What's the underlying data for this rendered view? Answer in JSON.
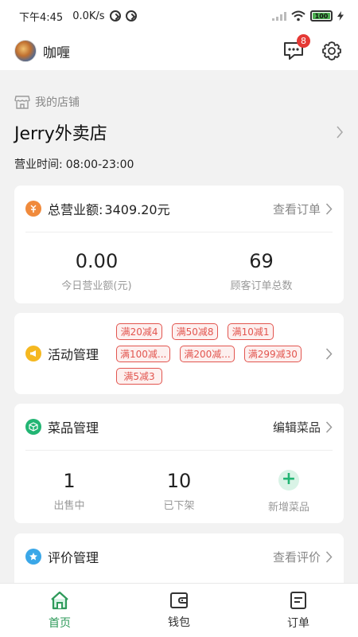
{
  "status": {
    "time": "下午4:45",
    "speed": "0.0K/s",
    "battery": "100"
  },
  "app": {
    "user_name": "咖喱",
    "message_badge": "8"
  },
  "store": {
    "section_label": "我的店铺",
    "name": "Jerry外卖店",
    "hours_label": "营业时间:",
    "hours": "08:00-23:00"
  },
  "revenue": {
    "title_label": "总营业额:",
    "total": "3409.20元",
    "link": "查看订单",
    "stats": [
      {
        "value": "0.00",
        "label": "今日营业额(元)"
      },
      {
        "value": "69",
        "label": "顾客订单总数"
      }
    ]
  },
  "activity": {
    "title": "活动管理",
    "tags": [
      "满20减4",
      "满50减8",
      "满10减1",
      "满100减...",
      "满200减...",
      "满299减30",
      "满5减3"
    ]
  },
  "dishes": {
    "title": "菜品管理",
    "link": "编辑菜品",
    "stats": [
      {
        "value": "1",
        "label": "出售中"
      },
      {
        "value": "10",
        "label": "已下架"
      }
    ],
    "add_label": "新增菜品",
    "add_symbol": "+"
  },
  "reviews": {
    "title": "评价管理",
    "link": "查看评价"
  },
  "tabs": [
    {
      "label": "首页",
      "icon": "home-icon",
      "active": true
    },
    {
      "label": "钱包",
      "icon": "wallet-icon",
      "active": false
    },
    {
      "label": "订单",
      "icon": "order-icon",
      "active": false
    }
  ],
  "colors": {
    "accent": "#2e9a5a",
    "tag_red": "#e2554f",
    "revenue_icon": "#f08a3c",
    "activity_icon": "#f5b820",
    "dishes_icon": "#22b573",
    "reviews_icon": "#3aa7e8"
  }
}
